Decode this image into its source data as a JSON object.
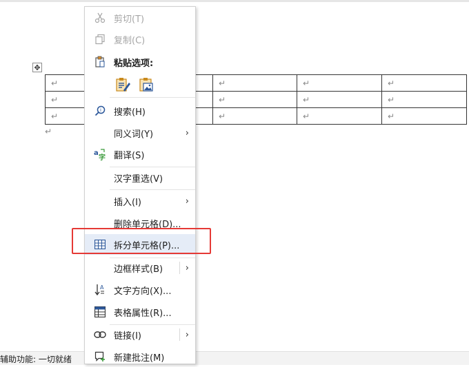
{
  "document": {
    "move_handle_glyph": "✥",
    "paragraph_mark": "↵",
    "table": {
      "rows": 3,
      "cells": [
        [
          "↵",
          "",
          "↵",
          "↵",
          "↵"
        ],
        [
          "↵",
          "",
          "↵",
          "↵",
          "↵"
        ],
        [
          "↵",
          "",
          "↵",
          "↵",
          "↵"
        ]
      ]
    }
  },
  "status_bar": {
    "text": "辅助功能: 一切就绪"
  },
  "context_menu": {
    "items": {
      "cut": "剪切(T)",
      "copy": "复制(C)",
      "paste_options": "粘贴选项:",
      "search": "搜索(H)",
      "synonyms": "同义词(Y)",
      "translate": "翻译(S)",
      "hanzi_reselect": "汉字重选(V)",
      "insert": "插入(I)",
      "delete_cells": "删除单元格(D)...",
      "split_cells": "拆分单元格(P)...",
      "border_style": "边框样式(B)",
      "text_direction": "文字方向(X)...",
      "table_properties": "表格属性(R)...",
      "link": "链接(I)",
      "new_comment": "新建批注(M)"
    },
    "submenu_arrow": "›"
  },
  "colors": {
    "accent": "#2b579a",
    "highlight_border": "#e53935",
    "hover_bg": "#e5ecf7"
  }
}
